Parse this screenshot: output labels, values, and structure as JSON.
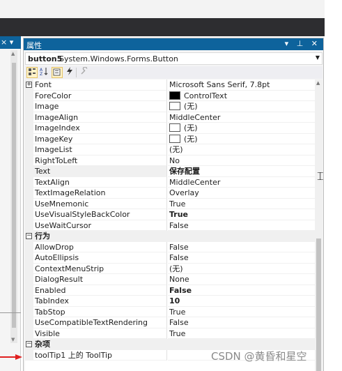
{
  "left_panel": {
    "header_buttons": "× ▾"
  },
  "properties_window": {
    "title": "属性",
    "title_buttons": "▾ ⊥ ✕",
    "object": {
      "name": "button5",
      "type": "System.Windows.Forms.Button"
    },
    "toolbar": {
      "categorized_icon": "categorized-icon",
      "alphabetical_icon": "alphabetical-icon",
      "properties_icon": "properties-icon",
      "events_icon": "lightning-icon",
      "property_pages_icon": "wrench-icon"
    },
    "appearance_rows": [
      {
        "name": "Font",
        "value": "Microsoft Sans Serif, 7.8pt",
        "expandable": true
      },
      {
        "name": "ForeColor",
        "value": "ControlText",
        "swatch": "#000000"
      },
      {
        "name": "Image",
        "value": "(无)",
        "swatch": "#ffffff"
      },
      {
        "name": "ImageAlign",
        "value": "MiddleCenter"
      },
      {
        "name": "ImageIndex",
        "value": "(无)",
        "swatch": "#ffffff"
      },
      {
        "name": "ImageKey",
        "value": "(无)",
        "swatch": "#ffffff"
      },
      {
        "name": "ImageList",
        "value": "(无)"
      },
      {
        "name": "RightToLeft",
        "value": "No"
      },
      {
        "name": "Text",
        "value": "保存配置",
        "bold": true
      },
      {
        "name": "TextAlign",
        "value": "MiddleCenter"
      },
      {
        "name": "TextImageRelation",
        "value": "Overlay"
      },
      {
        "name": "UseMnemonic",
        "value": "True"
      },
      {
        "name": "UseVisualStyleBackColor",
        "value": "True",
        "bold": true
      },
      {
        "name": "UseWaitCursor",
        "value": "False"
      }
    ],
    "behavior_category": "行为",
    "behavior_rows": [
      {
        "name": "AllowDrop",
        "value": "False"
      },
      {
        "name": "AutoEllipsis",
        "value": "False"
      },
      {
        "name": "ContextMenuStrip",
        "value": "(无)"
      },
      {
        "name": "DialogResult",
        "value": "None"
      },
      {
        "name": "Enabled",
        "value": "False",
        "bold": true
      },
      {
        "name": "TabIndex",
        "value": "10",
        "bold": true
      },
      {
        "name": "TabStop",
        "value": "True"
      },
      {
        "name": "UseCompatibleTextRendering",
        "value": "False"
      },
      {
        "name": "Visible",
        "value": "True"
      }
    ],
    "misc_category": "杂项",
    "misc_rows": [
      {
        "name": "toolTip1 上的 ToolTip",
        "value": ""
      }
    ]
  },
  "watermark": "CSDN @黄昏和星空",
  "colors": {
    "title_bar": "#0e639c",
    "dark_strip": "#2d2d30",
    "arrow": "#e02020"
  }
}
